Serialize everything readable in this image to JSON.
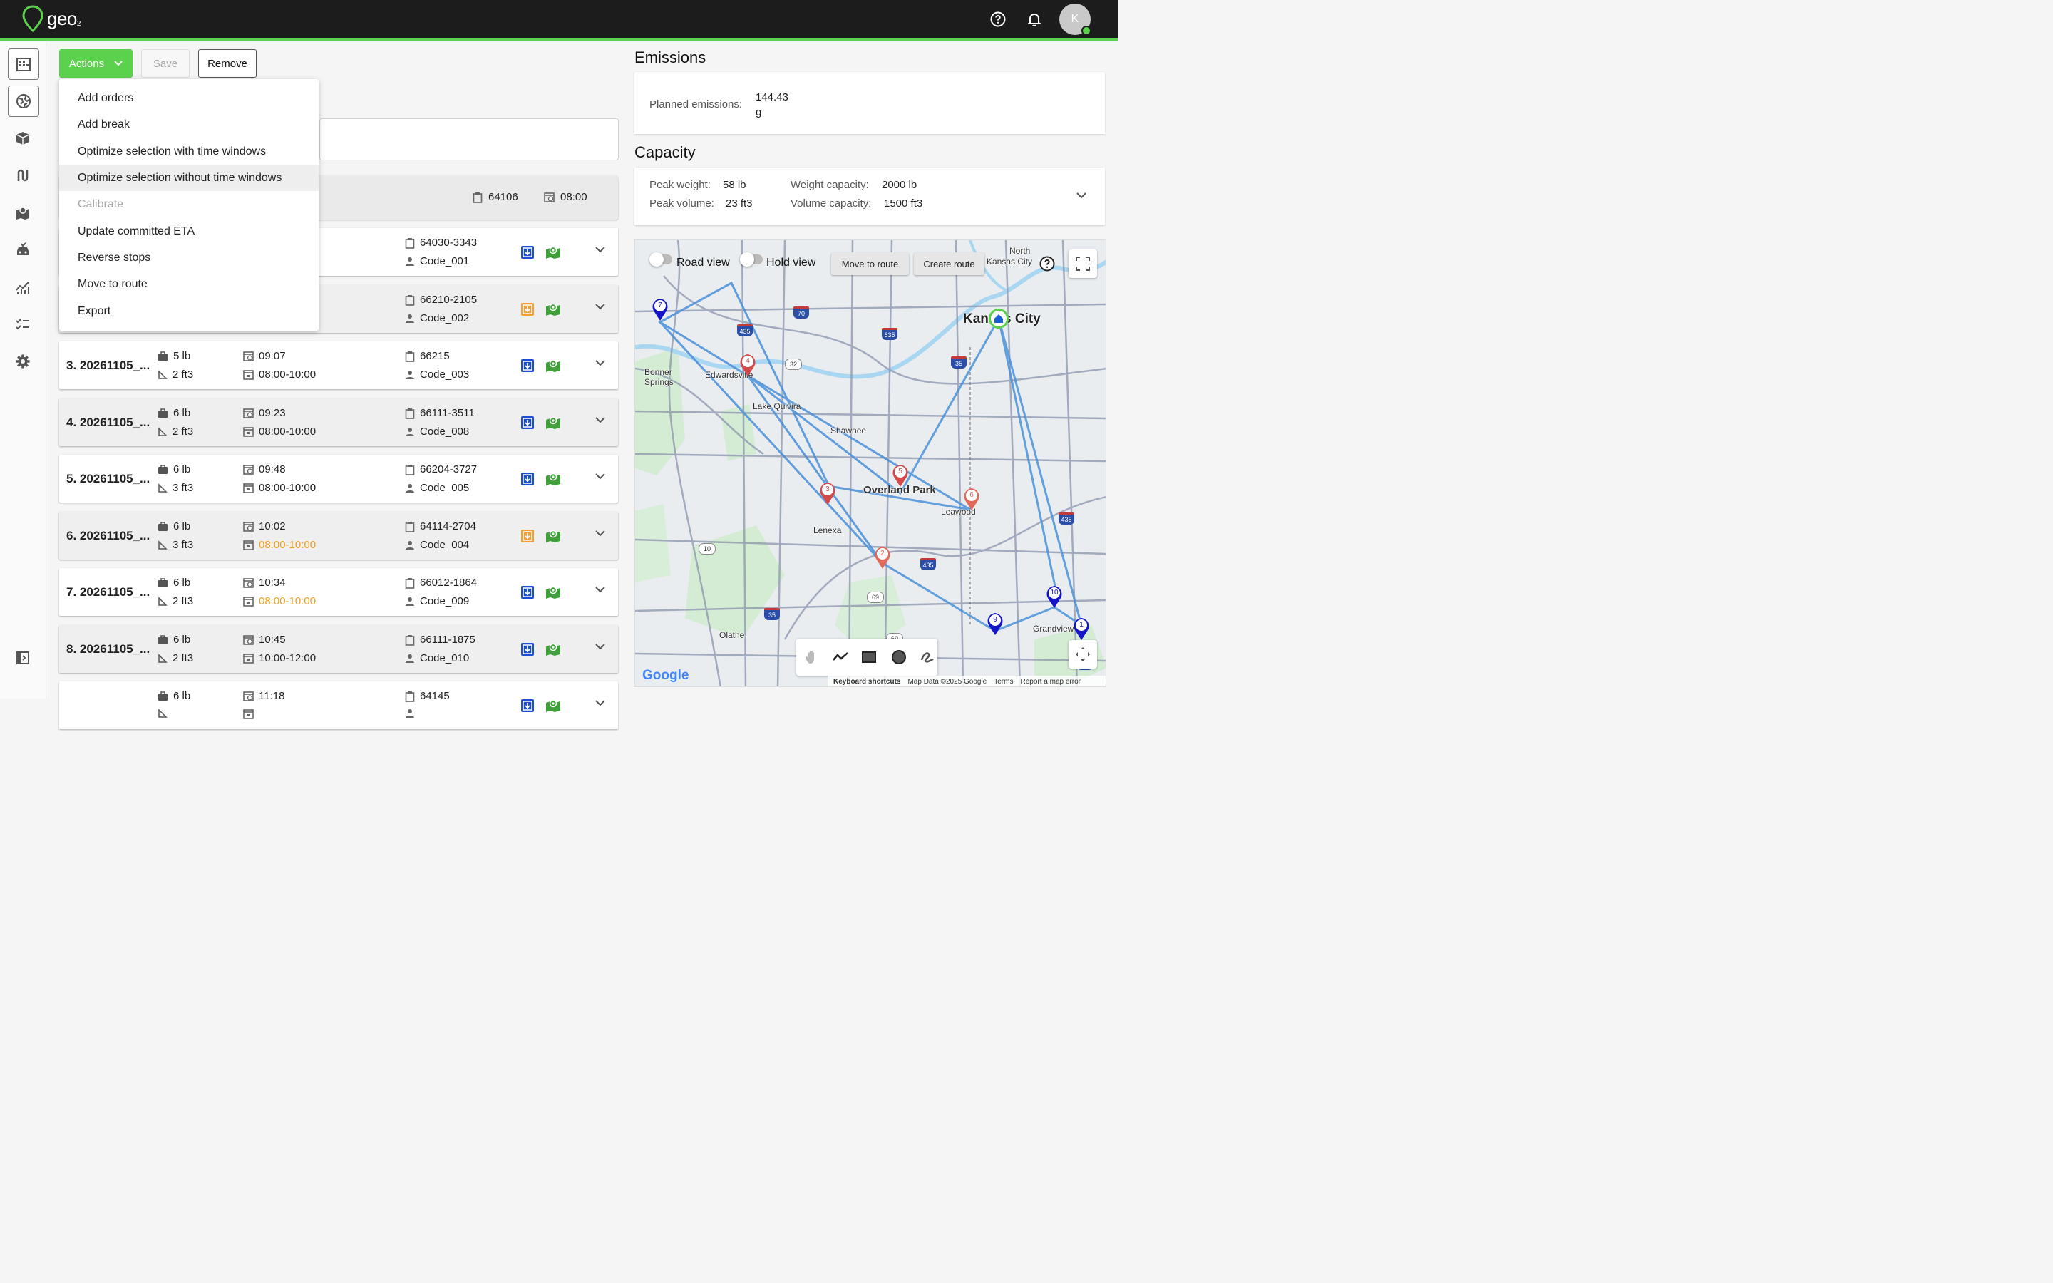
{
  "app": {
    "logo_text": "geo",
    "logo_sub": "2",
    "avatar_initial": "K"
  },
  "colors": {
    "accent": "#5cd14d",
    "topbar": "#1c1c1c",
    "route": "#4a90d9",
    "late": "#f0a020"
  },
  "toolbar": {
    "actions_label": "Actions",
    "save_label": "Save",
    "remove_label": "Remove"
  },
  "menu": {
    "items": [
      {
        "label": "Add orders"
      },
      {
        "label": "Add break"
      },
      {
        "label": "Optimize selection with time windows"
      },
      {
        "label": "Optimize selection without time windows"
      },
      {
        "label": "Calibrate"
      },
      {
        "label": "Update committed ETA"
      },
      {
        "label": "Reverse stops"
      },
      {
        "label": "Move to route"
      },
      {
        "label": "Export"
      }
    ]
  },
  "depot": {
    "zip": "64106",
    "time": "08:00"
  },
  "orders": [
    {
      "title": "",
      "weight": "",
      "volume": "",
      "eta": "",
      "window": "",
      "zip": "64030-3343",
      "code": "Code_001",
      "stop": "pickup"
    },
    {
      "title": "",
      "weight": "",
      "volume": "",
      "eta": "",
      "window": "",
      "zip": "66210-2105",
      "code": "Code_002",
      "stop": "dropoff"
    },
    {
      "title": "3. 20261105_...",
      "weight": "5 lb",
      "volume": "2 ft3",
      "eta": "09:07",
      "window": "08:00-10:00",
      "zip": "66215",
      "code": "Code_003",
      "stop": "pickup"
    },
    {
      "title": "4. 20261105_...",
      "weight": "6 lb",
      "volume": "2 ft3",
      "eta": "09:23",
      "window": "08:00-10:00",
      "zip": "66111-3511",
      "code": "Code_008",
      "stop": "pickup"
    },
    {
      "title": "5. 20261105_...",
      "weight": "6 lb",
      "volume": "3 ft3",
      "eta": "09:48",
      "window": "08:00-10:00",
      "zip": "66204-3727",
      "code": "Code_005",
      "stop": "pickup"
    },
    {
      "title": "6. 20261105_...",
      "weight": "6 lb",
      "volume": "3 ft3",
      "eta": "10:02",
      "window": "08:00-10:00",
      "zip": "64114-2704",
      "code": "Code_004",
      "stop": "dropoff"
    },
    {
      "title": "7. 20261105_...",
      "weight": "6 lb",
      "volume": "2 ft3",
      "eta": "10:34",
      "window": "08:00-10:00",
      "zip": "66012-1864",
      "code": "Code_009",
      "stop": "pickup"
    },
    {
      "title": "8. 20261105_...",
      "weight": "6 lb",
      "volume": "2 ft3",
      "eta": "10:45",
      "window": "10:00-12:00",
      "zip": "66111-1875",
      "code": "Code_010",
      "stop": "pickup"
    },
    {
      "title": "",
      "weight": "6 lb",
      "volume": "",
      "eta": "11:18",
      "window": "",
      "zip": "64145",
      "code": "",
      "stop": "pickup"
    }
  ],
  "emissions": {
    "heading": "Emissions",
    "label": "Planned emissions:",
    "value": "144.43",
    "unit": "g"
  },
  "capacity": {
    "heading": "Capacity",
    "peak_weight_label": "Peak weight:",
    "peak_weight": "58 lb",
    "peak_volume_label": "Peak volume:",
    "peak_volume": "23 ft3",
    "weight_capacity_label": "Weight capacity:",
    "weight_capacity": "2000 lb",
    "volume_capacity_label": "Volume capacity:",
    "volume_capacity": "1500 ft3"
  },
  "map": {
    "road_view_label": "Road view",
    "hold_view_label": "Hold view",
    "move_to_route_label": "Move to route",
    "create_route_label": "Create route",
    "places": {
      "north_kc": "North",
      "kansas_city_small": "Kansas City",
      "kansas_city": "Kansas City",
      "bonner_springs": "Bonner Springs",
      "edwardsville": "Edwardsville",
      "lake_quivira": "Lake Quivira",
      "shawnee": "Shawnee",
      "overland_park": "Overland Park",
      "leawood": "Leawood",
      "lenexa": "Lenexa",
      "olathe": "Olathe",
      "grandview": "Grandview"
    },
    "pin_labels": {
      "p1": "1",
      "p2": "2",
      "p3": "3",
      "p4": "4",
      "p5": "5",
      "p6": "6",
      "p7": "7",
      "p9": "9",
      "p10": "10"
    },
    "highway_labels": {
      "h435a": "435",
      "h70": "70",
      "h635": "635",
      "h35a": "35",
      "h32": "32",
      "h435b": "435",
      "h435c": "435",
      "h10": "10",
      "h69a": "69",
      "h35b": "35",
      "h69b": "69",
      "h49": "49"
    },
    "attribution": {
      "keyboard": "Keyboard shortcuts",
      "data": "Map Data ©2025 Google",
      "terms": "Terms",
      "report": "Report a map error"
    },
    "google_logo": "Google"
  }
}
